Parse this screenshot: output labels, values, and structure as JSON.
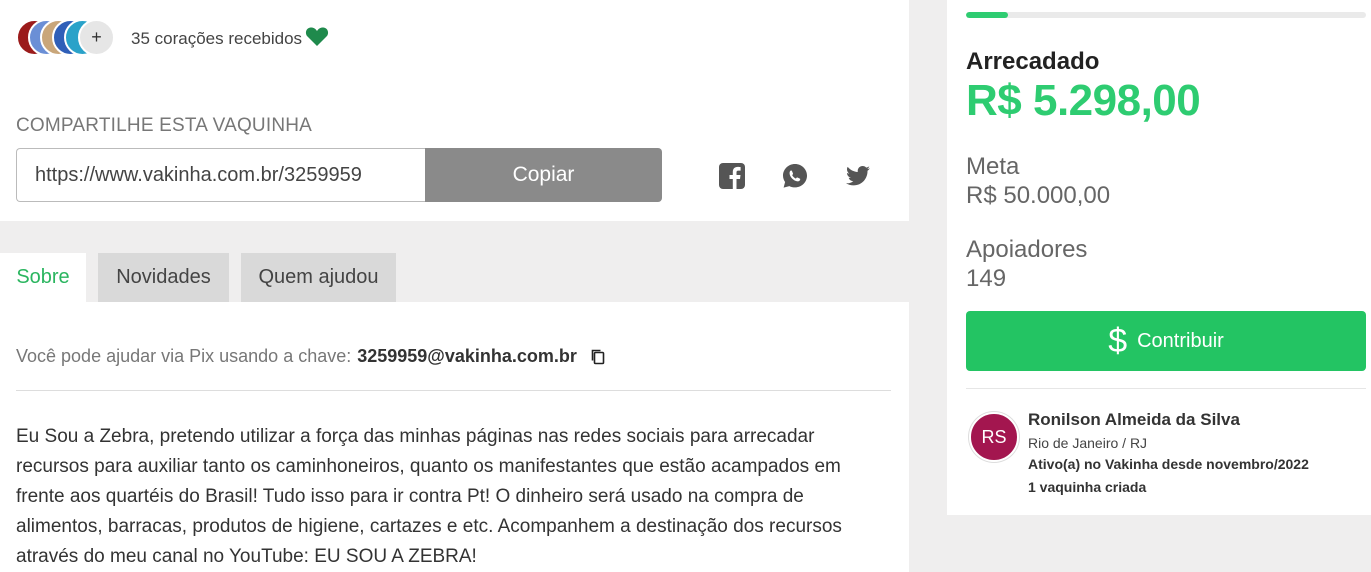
{
  "hearts": {
    "more_label": "+",
    "text": "35 corações recebidos",
    "icon": "heart-icon",
    "color": "#1f8a4c"
  },
  "share": {
    "title": "COMPARTILHE ESTA VAQUINHA",
    "url": "https://www.vakinha.com.br/3259959",
    "copy_label": "Copiar",
    "icons": [
      "facebook-icon",
      "whatsapp-icon",
      "twitter-icon"
    ]
  },
  "tabs": [
    {
      "label": "Sobre",
      "active": true
    },
    {
      "label": "Novidades",
      "active": false
    },
    {
      "label": "Quem ajudou",
      "active": false
    }
  ],
  "content": {
    "pix_text": "Você pode ajudar via Pix usando a chave:",
    "pix_key": "3259959@vakinha.com.br",
    "description": "Eu Sou a Zebra, pretendo utilizar a força das minhas páginas nas redes sociais para arrecadar recursos para auxiliar tanto os caminhoneiros, quanto os manifestantes que estão acampados em frente aos quartéis do Brasil! Tudo isso para ir contra Pt! O dinheiro será usado na compra de alimentos, barracas, produtos de higiene, cartazes e etc. Acompanhem a destinação dos recursos através do meu canal no YouTube: EU SOU A ZEBRA!"
  },
  "campaign": {
    "progress_percent": 10.6,
    "raised_label": "Arrecadado",
    "raised_value": "R$ 5.298,00",
    "goal_label": "Meta",
    "goal_value": "R$ 50.000,00",
    "supporters_label": "Apoiadores",
    "supporters_value": "149",
    "contribute_label": "Contribuir",
    "accent_color": "#23c463"
  },
  "owner": {
    "initials": "RS",
    "name": "Ronilson Almeida da Silva",
    "location": "Rio de Janeiro / RJ",
    "since": "Ativo(a) no Vakinha desde novembro/2022",
    "campaigns": "1 vaquinha criada"
  }
}
